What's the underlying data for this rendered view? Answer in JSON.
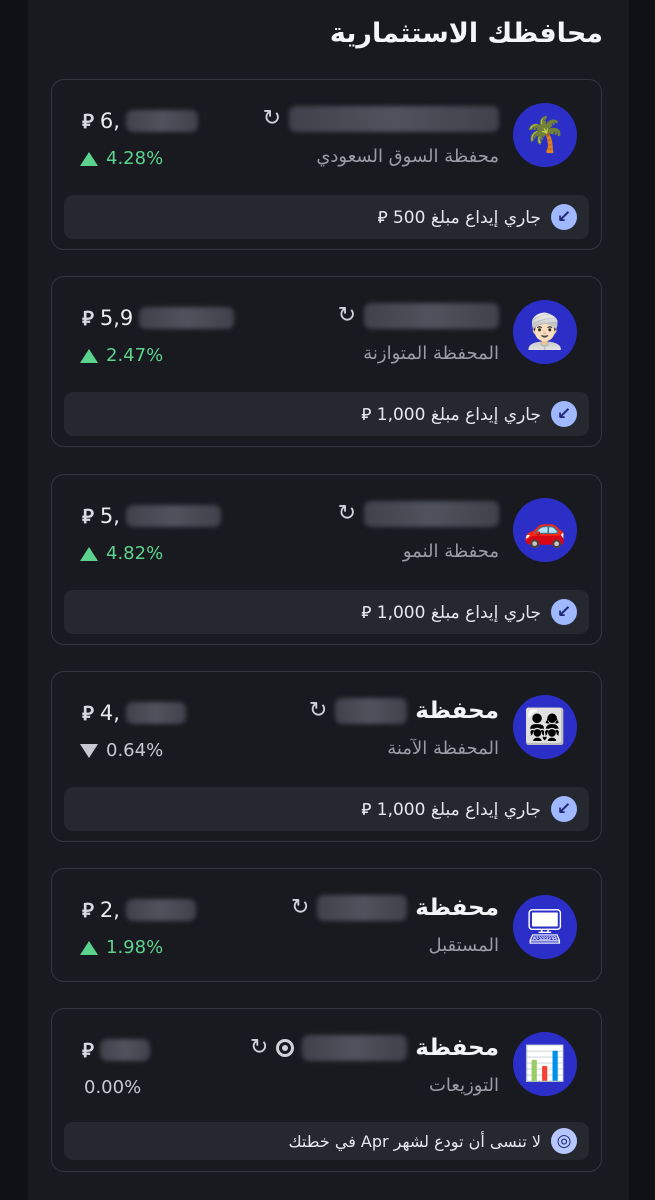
{
  "title": "محافظك الاستثمارية",
  "currency_symbol": "⃁",
  "sync_icon": "↻",
  "cards": [
    {
      "name": "محفظة السوق السعودي",
      "avatar_icon": "palm-tree-icon",
      "avatar_glyph": "🌴",
      "value": "6,",
      "change": "4.28%",
      "trend": "up",
      "notice": "جاري إيداع مبلغ 500 ⃁"
    },
    {
      "name": "المحفظة المتوازنة",
      "avatar_icon": "man-avatar-icon",
      "avatar_glyph": "👳🏻‍♂️",
      "value": "5,9",
      "change": "2.47%",
      "trend": "up",
      "notice": "جاري إيداع مبلغ 1,000 ⃁"
    },
    {
      "name": "محفظة النمو",
      "avatar_icon": "car-icon",
      "avatar_glyph": "🚗",
      "value": "5,",
      "change": "4.82%",
      "trend": "up",
      "notice": "جاري إيداع مبلغ 1,000 ⃁"
    },
    {
      "name_top": "محفظة",
      "name": "المحفظة الآمنة",
      "avatar_icon": "family-icon",
      "avatar_glyph": "👨‍👩‍👧‍👧",
      "value": "4,",
      "change": "0.64%",
      "trend": "down",
      "notice": "جاري إيداع مبلغ 1,000 ⃁"
    },
    {
      "name_top": "محفظة",
      "name": "المستقبل",
      "avatar_icon": "monitor-icon",
      "avatar_glyph": "🖥",
      "value": "2,",
      "change": "1.98%",
      "trend": "up"
    },
    {
      "name_top": "محفظة",
      "name": "التوزيعات",
      "avatar_icon": "bar-chart-icon",
      "avatar_glyph": "📊",
      "value": "",
      "change": "0.00%",
      "trend": "none",
      "notice": "لا تنسى أن تودع لشهر Apr في خطتك"
    }
  ]
}
